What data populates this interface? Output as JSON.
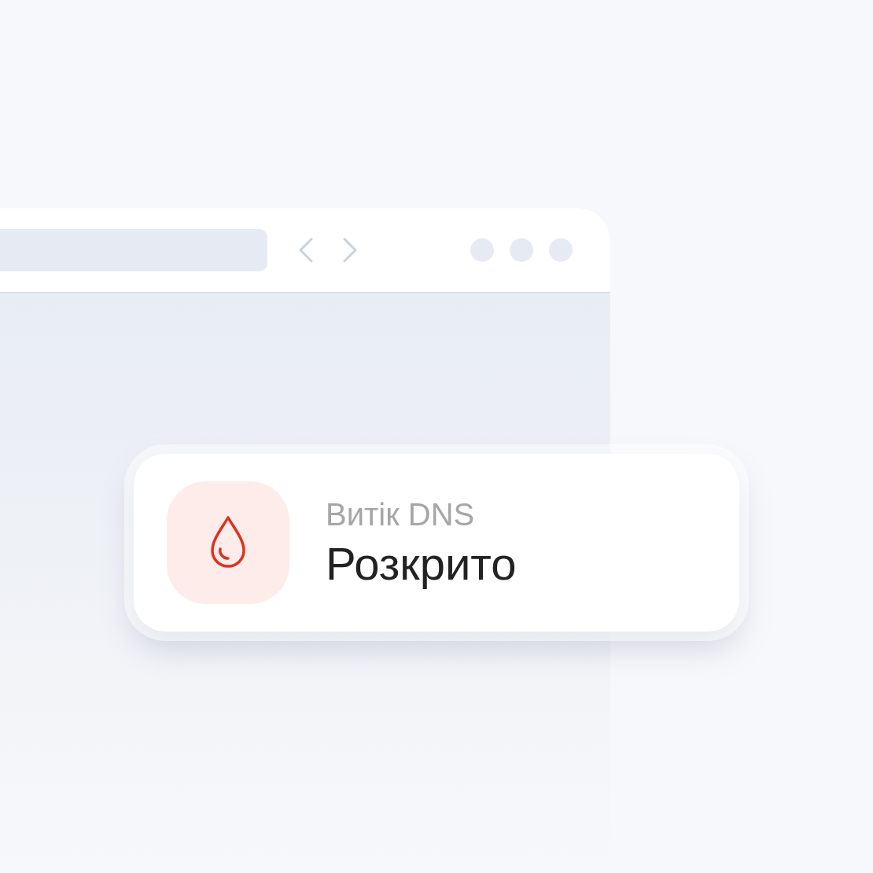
{
  "card": {
    "label": "Витік DNS",
    "status": "Розкрито"
  }
}
